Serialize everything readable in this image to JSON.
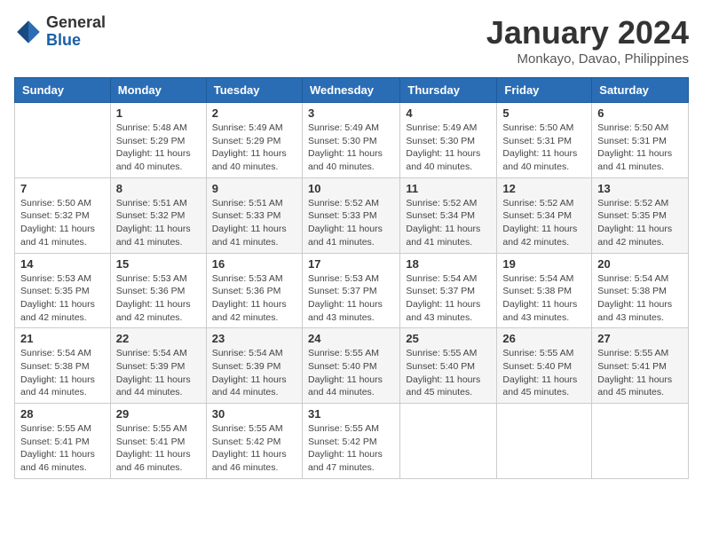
{
  "header": {
    "logo_general": "General",
    "logo_blue": "Blue",
    "month": "January 2024",
    "location": "Monkayo, Davao, Philippines"
  },
  "days_of_week": [
    "Sunday",
    "Monday",
    "Tuesday",
    "Wednesday",
    "Thursday",
    "Friday",
    "Saturday"
  ],
  "weeks": [
    [
      {
        "day": "",
        "info": ""
      },
      {
        "day": "1",
        "info": "Sunrise: 5:48 AM\nSunset: 5:29 PM\nDaylight: 11 hours\nand 40 minutes."
      },
      {
        "day": "2",
        "info": "Sunrise: 5:49 AM\nSunset: 5:29 PM\nDaylight: 11 hours\nand 40 minutes."
      },
      {
        "day": "3",
        "info": "Sunrise: 5:49 AM\nSunset: 5:30 PM\nDaylight: 11 hours\nand 40 minutes."
      },
      {
        "day": "4",
        "info": "Sunrise: 5:49 AM\nSunset: 5:30 PM\nDaylight: 11 hours\nand 40 minutes."
      },
      {
        "day": "5",
        "info": "Sunrise: 5:50 AM\nSunset: 5:31 PM\nDaylight: 11 hours\nand 40 minutes."
      },
      {
        "day": "6",
        "info": "Sunrise: 5:50 AM\nSunset: 5:31 PM\nDaylight: 11 hours\nand 41 minutes."
      }
    ],
    [
      {
        "day": "7",
        "info": "Sunrise: 5:50 AM\nSunset: 5:32 PM\nDaylight: 11 hours\nand 41 minutes."
      },
      {
        "day": "8",
        "info": "Sunrise: 5:51 AM\nSunset: 5:32 PM\nDaylight: 11 hours\nand 41 minutes."
      },
      {
        "day": "9",
        "info": "Sunrise: 5:51 AM\nSunset: 5:33 PM\nDaylight: 11 hours\nand 41 minutes."
      },
      {
        "day": "10",
        "info": "Sunrise: 5:52 AM\nSunset: 5:33 PM\nDaylight: 11 hours\nand 41 minutes."
      },
      {
        "day": "11",
        "info": "Sunrise: 5:52 AM\nSunset: 5:34 PM\nDaylight: 11 hours\nand 41 minutes."
      },
      {
        "day": "12",
        "info": "Sunrise: 5:52 AM\nSunset: 5:34 PM\nDaylight: 11 hours\nand 42 minutes."
      },
      {
        "day": "13",
        "info": "Sunrise: 5:52 AM\nSunset: 5:35 PM\nDaylight: 11 hours\nand 42 minutes."
      }
    ],
    [
      {
        "day": "14",
        "info": "Sunrise: 5:53 AM\nSunset: 5:35 PM\nDaylight: 11 hours\nand 42 minutes."
      },
      {
        "day": "15",
        "info": "Sunrise: 5:53 AM\nSunset: 5:36 PM\nDaylight: 11 hours\nand 42 minutes."
      },
      {
        "day": "16",
        "info": "Sunrise: 5:53 AM\nSunset: 5:36 PM\nDaylight: 11 hours\nand 42 minutes."
      },
      {
        "day": "17",
        "info": "Sunrise: 5:53 AM\nSunset: 5:37 PM\nDaylight: 11 hours\nand 43 minutes."
      },
      {
        "day": "18",
        "info": "Sunrise: 5:54 AM\nSunset: 5:37 PM\nDaylight: 11 hours\nand 43 minutes."
      },
      {
        "day": "19",
        "info": "Sunrise: 5:54 AM\nSunset: 5:38 PM\nDaylight: 11 hours\nand 43 minutes."
      },
      {
        "day": "20",
        "info": "Sunrise: 5:54 AM\nSunset: 5:38 PM\nDaylight: 11 hours\nand 43 minutes."
      }
    ],
    [
      {
        "day": "21",
        "info": "Sunrise: 5:54 AM\nSunset: 5:38 PM\nDaylight: 11 hours\nand 44 minutes."
      },
      {
        "day": "22",
        "info": "Sunrise: 5:54 AM\nSunset: 5:39 PM\nDaylight: 11 hours\nand 44 minutes."
      },
      {
        "day": "23",
        "info": "Sunrise: 5:54 AM\nSunset: 5:39 PM\nDaylight: 11 hours\nand 44 minutes."
      },
      {
        "day": "24",
        "info": "Sunrise: 5:55 AM\nSunset: 5:40 PM\nDaylight: 11 hours\nand 44 minutes."
      },
      {
        "day": "25",
        "info": "Sunrise: 5:55 AM\nSunset: 5:40 PM\nDaylight: 11 hours\nand 45 minutes."
      },
      {
        "day": "26",
        "info": "Sunrise: 5:55 AM\nSunset: 5:40 PM\nDaylight: 11 hours\nand 45 minutes."
      },
      {
        "day": "27",
        "info": "Sunrise: 5:55 AM\nSunset: 5:41 PM\nDaylight: 11 hours\nand 45 minutes."
      }
    ],
    [
      {
        "day": "28",
        "info": "Sunrise: 5:55 AM\nSunset: 5:41 PM\nDaylight: 11 hours\nand 46 minutes."
      },
      {
        "day": "29",
        "info": "Sunrise: 5:55 AM\nSunset: 5:41 PM\nDaylight: 11 hours\nand 46 minutes."
      },
      {
        "day": "30",
        "info": "Sunrise: 5:55 AM\nSunset: 5:42 PM\nDaylight: 11 hours\nand 46 minutes."
      },
      {
        "day": "31",
        "info": "Sunrise: 5:55 AM\nSunset: 5:42 PM\nDaylight: 11 hours\nand 47 minutes."
      },
      {
        "day": "",
        "info": ""
      },
      {
        "day": "",
        "info": ""
      },
      {
        "day": "",
        "info": ""
      }
    ]
  ]
}
